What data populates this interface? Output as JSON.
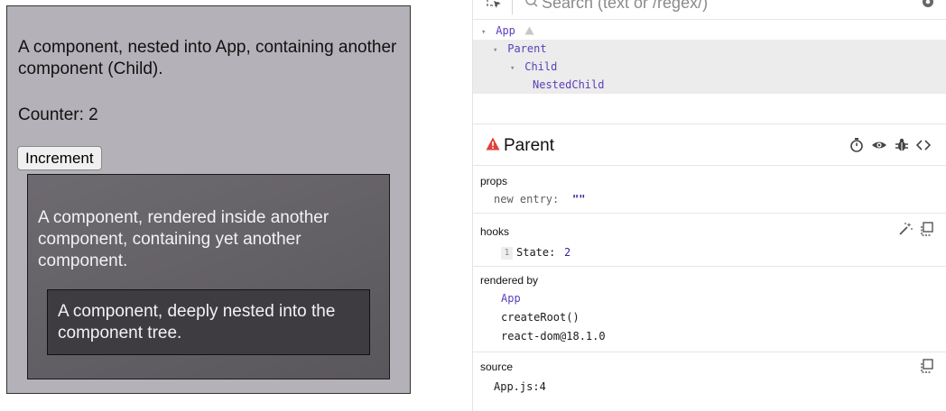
{
  "app": {
    "parent_text": "A component, nested into App, containing another component (Child).",
    "counter_label": "Counter: 2",
    "increment_label": "Increment",
    "child_text": "A component, rendered inside another component, containing yet another component.",
    "nested_text": "A component, deeply nested into the component tree."
  },
  "devtools": {
    "search_placeholder": "Search (text or /regex/)",
    "tree": [
      {
        "label": "App",
        "depth": 0,
        "arrow": "▾",
        "warning": true,
        "selected": false
      },
      {
        "label": "Parent",
        "depth": 1,
        "arrow": "▾",
        "warning": false,
        "selected": true
      },
      {
        "label": "Child",
        "depth": 2,
        "arrow": "▾",
        "warning": false,
        "selected": true
      },
      {
        "label": "NestedChild",
        "depth": 3,
        "arrow": "",
        "warning": false,
        "selected": true
      }
    ],
    "selected": {
      "name": "Parent",
      "props_label": "props",
      "props": [
        {
          "key": "new entry:",
          "value": "\"\""
        }
      ],
      "hooks_label": "hooks",
      "hooks": [
        {
          "index": "1",
          "name": "State:",
          "value": "2"
        }
      ],
      "rendered_by_label": "rendered by",
      "rendered_by": [
        "App",
        "createRoot()",
        "react-dom@18.1.0"
      ],
      "source_label": "source",
      "source": "App.js:4"
    }
  },
  "colors": {
    "component_name": "#5b3fb8",
    "value": "#3d1f9e",
    "warning": "#e0413b",
    "parent_bg": "#b4b1b8",
    "child_bg": "#5f5c62",
    "nested_bg": "#3f3c41"
  },
  "icons": {
    "toolbar": [
      "inspect-icon",
      "search-icon",
      "settings-icon"
    ],
    "header": [
      "stopwatch-icon",
      "eye-icon",
      "bug-icon",
      "code-brackets-icon"
    ],
    "hooks": [
      "magic-wand-icon",
      "copy-icon"
    ],
    "source": [
      "copy-icon"
    ]
  }
}
